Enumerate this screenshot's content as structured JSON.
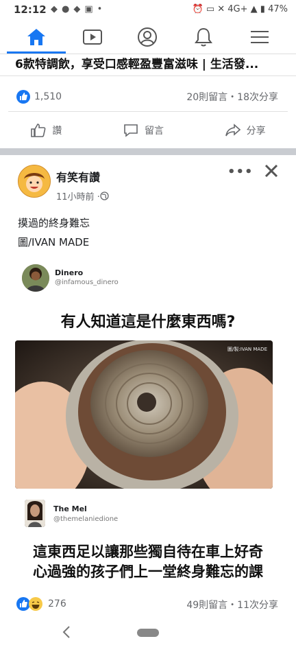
{
  "status_bar": {
    "time": "12:12",
    "network": "4G+",
    "battery": "47%"
  },
  "prev_post": {
    "title": "6款特調飲，享受口感輕盈豐富滋味 | 生活發...",
    "likes": "1,510",
    "meta": "20則留言・18次分享"
  },
  "actions": {
    "like": "讚",
    "comment": "留言",
    "share": "分享"
  },
  "post": {
    "page_name": "有笑有讚",
    "time": "11小時前 · ",
    "caption_line1": "摸過的終身難忘",
    "caption_line2": "圖/IVAN MADE",
    "tweet1": {
      "name": "Dinero",
      "handle": "@infamous_dinero",
      "text": "有人知道這是什麼東西嗎?"
    },
    "image_watermark": "圖/製:IVAN MADE",
    "tweet2": {
      "name": "The Mel",
      "handle": "@themelaniedione",
      "text_line1": "這東西足以讓那些獨自待在車上好奇",
      "text_line2": "心過強的孩子們上一堂終身難忘的課"
    },
    "reactions": "276",
    "meta": "49則留言・11次分享"
  },
  "colors": {
    "brand": "#1877f2",
    "muted": "#65676b",
    "separator": "#c9ccd1"
  }
}
